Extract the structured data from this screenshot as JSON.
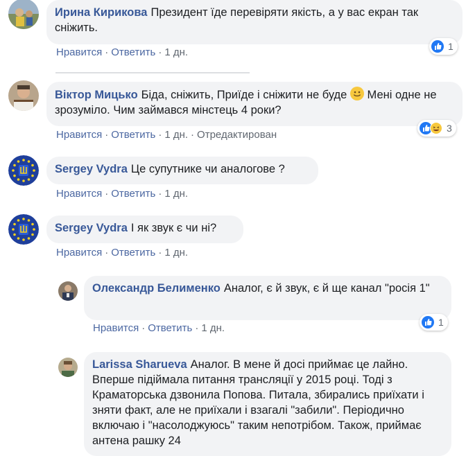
{
  "comments": [
    {
      "author": "Ирина Кирикова",
      "text": "Президент їде перевіряти якість, а у вас екран так сніжить.",
      "actions": {
        "like": "Нравится",
        "reply": "Ответить",
        "time": "1 дн."
      },
      "reactions": {
        "count": "1",
        "icons": [
          "like-icon"
        ]
      }
    },
    {
      "author": "Віктор Мицько",
      "text_before_emoji": "Біда, сніжить, Приїде і сніжити не буде",
      "text_after_emoji": "Мені одне не зрозуміло. Чим займався мінстець 4 роки?",
      "actions": {
        "like": "Нравится",
        "reply": "Ответить",
        "time": "1 дн.",
        "edited": "Отредактирован"
      },
      "reactions": {
        "count": "3",
        "icons": [
          "like-icon",
          "haha-icon"
        ]
      }
    },
    {
      "author": "Sergey Vydra",
      "text": "Це супутнике чи аналогове ?",
      "actions": {
        "like": "Нравится",
        "reply": "Ответить",
        "time": "1 дн."
      }
    },
    {
      "author": "Sergey Vydra",
      "text": "І як звук є чи ні?",
      "actions": {
        "like": "Нравится",
        "reply": "Ответить",
        "time": "1 дн."
      }
    }
  ],
  "replies": [
    {
      "author": "Олександр Белименко",
      "text": "Аналог, є й звук, є й ще канал \"росія 1\"",
      "actions": {
        "like": "Нравится",
        "reply": "Ответить",
        "time": "1 дн."
      },
      "reactions": {
        "count": "1",
        "icons": [
          "like-icon"
        ]
      }
    },
    {
      "author": "Larissa Sharueva",
      "text": "Аналог. В мене й досі приймає це лайно. Вперше підіймала питання трансляції у 2015 році. Тоді з Краматорська дзвонила Попова. Питала, збирались приїхати і зняти факт, але не приїхали і взагалі \"забили\". Періодично включаю і \"насолоджуюсь\" таким непотрібом. Також, приймає антена рашку 24"
    }
  ],
  "colors": {
    "link": "#385898",
    "bubble": "#f2f3f5",
    "like": "#2078f4"
  }
}
